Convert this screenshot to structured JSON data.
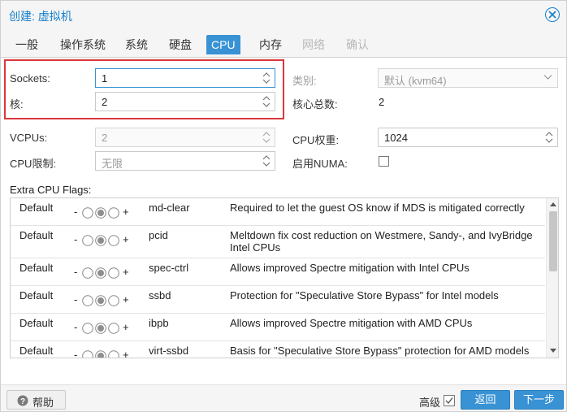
{
  "window": {
    "title": "创建: 虚拟机"
  },
  "tabs": [
    {
      "label": "一般",
      "state": "normal"
    },
    {
      "label": "操作系统",
      "state": "normal"
    },
    {
      "label": "系统",
      "state": "normal"
    },
    {
      "label": "硬盘",
      "state": "normal"
    },
    {
      "label": "CPU",
      "state": "active"
    },
    {
      "label": "内存",
      "state": "normal"
    },
    {
      "label": "网络",
      "state": "disabled"
    },
    {
      "label": "确认",
      "state": "disabled"
    }
  ],
  "cpu": {
    "sockets_label": "Sockets:",
    "sockets_value": "1",
    "cores_label": "核:",
    "cores_value": "2",
    "type_label": "类别:",
    "type_value": "默认 (kvm64)",
    "total_cores_label": "核心总数:",
    "total_cores_value": "2",
    "vcpus_label": "VCPUs:",
    "vcpus_value": "2",
    "cpu_weight_label": "CPU权重:",
    "cpu_weight_value": "1024",
    "cpu_limit_label": "CPU限制:",
    "cpu_limit_value": "无限",
    "numa_label": "启用NUMA:"
  },
  "flags": {
    "title": "Extra CPU Flags:",
    "minus": "-",
    "plus": "+",
    "rows": [
      {
        "state": "Default",
        "name": "md-clear",
        "description": "Required to let the guest OS know if MDS is mitigated correctly"
      },
      {
        "state": "Default",
        "name": "pcid",
        "description": "Meltdown fix cost reduction on Westmere, Sandy-, and IvyBridge Intel CPUs"
      },
      {
        "state": "Default",
        "name": "spec-ctrl",
        "description": "Allows improved Spectre mitigation with Intel CPUs"
      },
      {
        "state": "Default",
        "name": "ssbd",
        "description": "Protection for \"Speculative Store Bypass\" for Intel models"
      },
      {
        "state": "Default",
        "name": "ibpb",
        "description": "Allows improved Spectre mitigation with AMD CPUs"
      },
      {
        "state": "Default",
        "name": "virt-ssbd",
        "description": "Basis for \"Speculative Store Bypass\" protection for AMD models"
      }
    ]
  },
  "footer": {
    "help_label": "帮助",
    "advanced_label": "高级",
    "back_label": "返回",
    "next_label": "下一步"
  },
  "colors": {
    "accent": "#3892d4",
    "title": "#157fcc",
    "highlight": "#d9373b"
  }
}
